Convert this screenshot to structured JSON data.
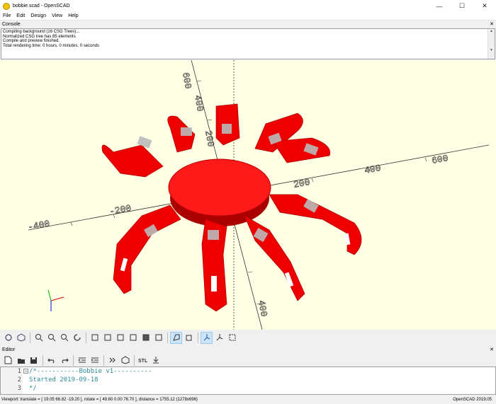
{
  "window": {
    "title": "bobbie.scad - OpenSCAD",
    "min": "—",
    "max": "☐",
    "close": "✕"
  },
  "menu": [
    "File",
    "Edit",
    "Design",
    "View",
    "Help"
  ],
  "console": {
    "title": "Console",
    "lines": [
      "Compiling background (16 CSG Trees)...",
      "Normalized CSG tree has 85 elements",
      "Compile and preview finished.",
      "Total rendering time: 0 hours, 0 minutes, 0 seconds"
    ]
  },
  "axes": {
    "labels": [
      "600",
      "400",
      "200",
      "200",
      "400",
      "600",
      "-200",
      "-400",
      "400"
    ]
  },
  "colors": {
    "model": "#ff1a1a",
    "model_dark": "#b30000",
    "background": "#ffffe5",
    "accent": "#2e8b9a"
  },
  "toolbar_icons": [
    "render-icon",
    "preview-icon",
    "zoom-in-icon",
    "zoom-out-icon",
    "zoom-all-icon",
    "reset-view-icon",
    "view-right-icon",
    "view-top-icon",
    "view-bottom-icon",
    "view-left-icon",
    "view-front-icon",
    "view-back-icon",
    "perspective-icon",
    "orthogonal-icon",
    "show-axes-icon",
    "show-scale-icon",
    "show-edges-icon"
  ],
  "editor": {
    "title": "Editor",
    "line_numbers": [
      "1",
      "2",
      "3"
    ],
    "lines": [
      "/*-----------Bobbie v1----------",
      "Started 2019-09-18",
      "*/"
    ]
  },
  "status": {
    "left": "Viewport: translate = [ 19.05 66.82 -19.20 ], rotate = [ 49.60 0.00 76.70 ], distance = 1755.12 (1278x696)",
    "right": "OpenSCAD 2019.05"
  }
}
